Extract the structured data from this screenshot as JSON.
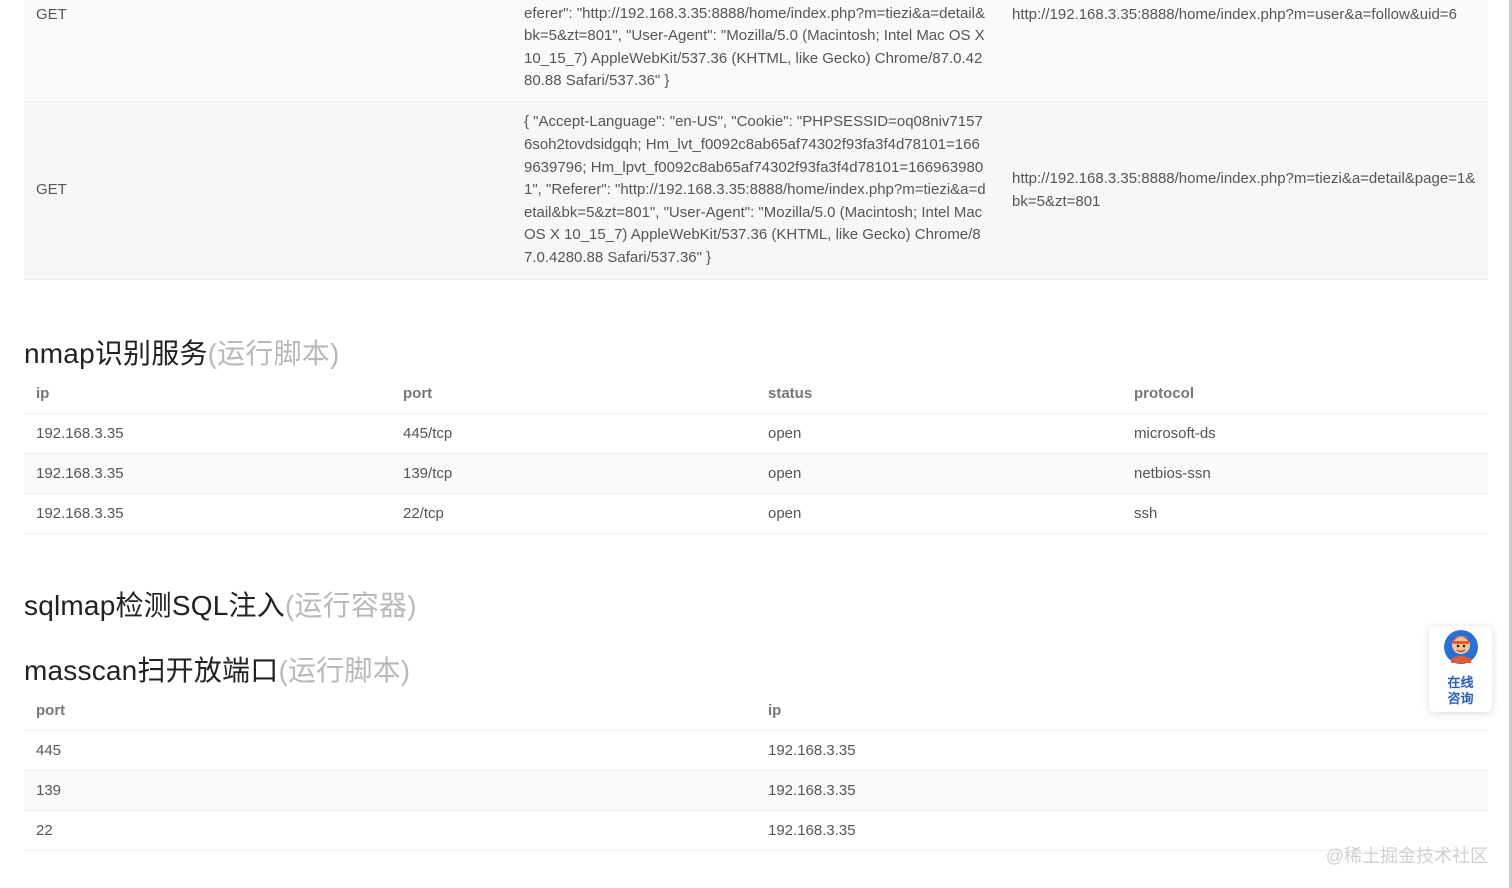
{
  "requests": {
    "rows": [
      {
        "method": "GET",
        "headers": "eferer\": \"http://192.168.3.35:8888/home/index.php?m=tiezi&a=detail&bk=5&zt=801\", \"User-Agent\": \"Mozilla/5.0 (Macintosh; Intel Mac OS X 10_15_7) AppleWebKit/537.36 (KHTML, like Gecko) Chrome/87.0.4280.88 Safari/537.36\" }",
        "url": "http://192.168.3.35:8888/home/index.php?m=user&a=follow&uid=6"
      },
      {
        "method": "GET",
        "headers": "{ \"Accept-Language\": \"en-US\", \"Cookie\": \"PHPSESSID=oq08niv71576soh2tovdsidgqh; Hm_lvt_f0092c8ab65af74302f93fa3f4d78101=1669639796; Hm_lpvt_f0092c8ab65af74302f93fa3f4d78101=1669639801\", \"Referer\": \"http://192.168.3.35:8888/home/index.php?m=tiezi&a=detail&bk=5&zt=801\", \"User-Agent\": \"Mozilla/5.0 (Macintosh; Intel Mac OS X 10_15_7) AppleWebKit/537.36 (KHTML, like Gecko) Chrome/87.0.4280.88 Safari/537.36\" }",
        "url": "http://192.168.3.35:8888/home/index.php?m=tiezi&a=detail&page=1&bk=5&zt=801"
      }
    ]
  },
  "nmap": {
    "title": "nmap识别服务",
    "subtitle": "(运行脚本)",
    "columns": [
      "ip",
      "port",
      "status",
      "protocol"
    ],
    "rows": [
      [
        "192.168.3.35",
        "445/tcp",
        "open",
        "microsoft-ds"
      ],
      [
        "192.168.3.35",
        "139/tcp",
        "open",
        "netbios-ssn"
      ],
      [
        "192.168.3.35",
        "22/tcp",
        "open",
        "ssh"
      ]
    ]
  },
  "sqlmap": {
    "title": "sqlmap检测SQL注入",
    "subtitle": "(运行容器)"
  },
  "masscan": {
    "title": "masscan扫开放端口",
    "subtitle": "(运行脚本)",
    "columns": [
      "port",
      "ip"
    ],
    "rows": [
      [
        "445",
        "192.168.3.35"
      ],
      [
        "139",
        "192.168.3.35"
      ],
      [
        "22",
        "192.168.3.35"
      ]
    ]
  },
  "chat_widget": {
    "line1": "在线",
    "line2": "咨询",
    "color": "#2b5cb8"
  },
  "watermark": "@稀土掘金技术社区"
}
